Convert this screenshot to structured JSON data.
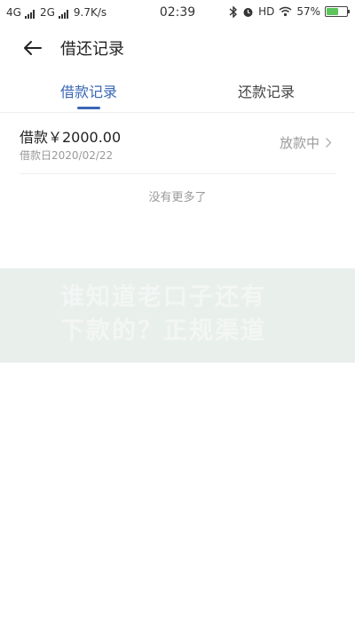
{
  "status_bar": {
    "network1": "4G",
    "network2": "2G",
    "speed": "9.7K/s",
    "time": "02:39",
    "hd": "HD",
    "battery": "57%",
    "battery_level": 0.57
  },
  "header": {
    "title": "借还记录"
  },
  "tabs": [
    {
      "label": "借款记录",
      "active": true
    },
    {
      "label": "还款记录",
      "active": false
    }
  ],
  "record": {
    "amount": "借款￥2000.00",
    "date": "借款日2020/02/22",
    "status": "放款中"
  },
  "footer_text": "没有更多了",
  "banner": {
    "text": "谁知道老口子还有\n下款的？正规渠道"
  },
  "colors": {
    "accent": "#3a67b6",
    "muted": "#9a9a9a"
  }
}
